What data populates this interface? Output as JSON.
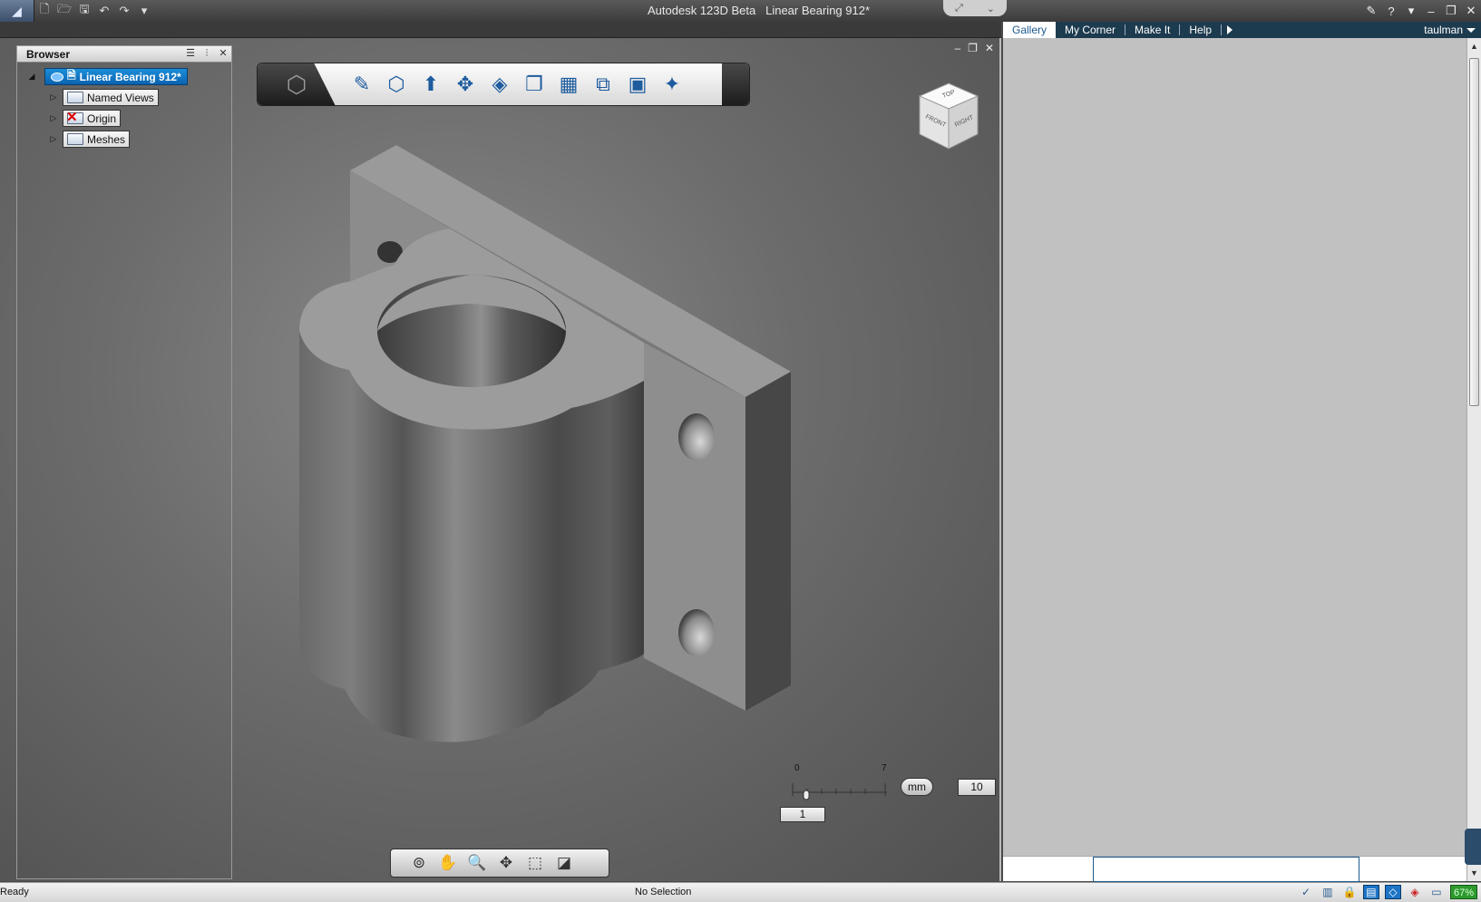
{
  "window": {
    "app_name": "Autodesk 123D Beta",
    "document_name": "Linear Bearing 912*"
  },
  "quick_access": {
    "icons": [
      "new-icon",
      "open-icon",
      "save-icon",
      "undo-icon",
      "redo-icon",
      "dropdown-icon"
    ]
  },
  "browser": {
    "title": "Browser",
    "root": "Linear Bearing 912*",
    "items": [
      {
        "label": "Named Views",
        "icon": "folder-icon"
      },
      {
        "label": "Origin",
        "icon": "folder-hidden-icon"
      },
      {
        "label": "Meshes",
        "icon": "folder-icon"
      }
    ]
  },
  "ribbon": {
    "tools": [
      "sketch-icon",
      "primitives-icon",
      "extrude-icon",
      "move-icon",
      "modify-icon",
      "combine-icon",
      "pattern-icon",
      "assemble-icon",
      "2d-drawing-icon",
      "make-icon"
    ]
  },
  "viewcube": {
    "top": "TOP",
    "front": "FRONT",
    "right": "RIGHT"
  },
  "scale": {
    "tick_start": "0",
    "tick_end": "7",
    "unit": "mm",
    "grid_value": "10",
    "snap_value": "1"
  },
  "navbar": {
    "tools": [
      "orbit-icon",
      "pan-icon",
      "zoom-icon",
      "look-at-icon",
      "fit-icon",
      "view-style-icon"
    ]
  },
  "right_panel": {
    "tabs": [
      "Gallery",
      "My Corner",
      "Make It",
      "Help"
    ],
    "active_tab": "Gallery",
    "user": "taulman"
  },
  "status": {
    "left": "Ready",
    "center": "No Selection",
    "zoom_percent": "67%"
  },
  "colors": {
    "accent": "#1d74c5",
    "tab_bar": "#1d3b4f",
    "model": "#9a9a9a"
  }
}
